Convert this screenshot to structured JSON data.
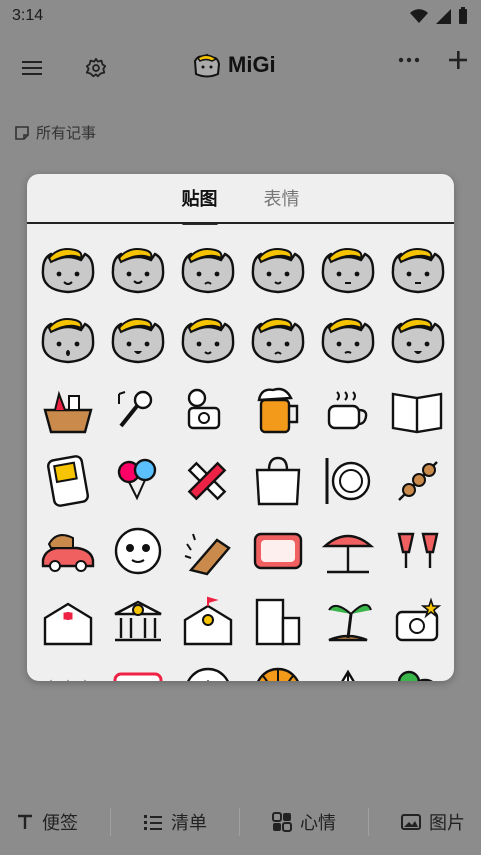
{
  "status": {
    "time": "3:14"
  },
  "brand": {
    "name": "MiGi"
  },
  "notes": {
    "label": "所有记事"
  },
  "sheet": {
    "tabs": [
      "贴图",
      "表情"
    ],
    "active_index": 0
  },
  "stickers": [
    {
      "type": "cat-happy"
    },
    {
      "type": "cat-smile"
    },
    {
      "type": "cat-angry"
    },
    {
      "type": "cat-wink"
    },
    {
      "type": "cat-sleepy"
    },
    {
      "type": "cat-serious"
    },
    {
      "type": "cat-surprised"
    },
    {
      "type": "cat-laugh"
    },
    {
      "type": "cat-shy"
    },
    {
      "type": "cat-cry"
    },
    {
      "type": "cat-tired"
    },
    {
      "type": "cat-happy2"
    },
    {
      "type": "basket-icon"
    },
    {
      "type": "music-mic-icon"
    },
    {
      "type": "camera-film-icon"
    },
    {
      "type": "beer-icon"
    },
    {
      "type": "coffee-icon"
    },
    {
      "type": "book-icon"
    },
    {
      "type": "gameboy-icon"
    },
    {
      "type": "balloons-icon"
    },
    {
      "type": "ruler-pencil-icon"
    },
    {
      "type": "shop-bag-icon"
    },
    {
      "type": "plate-icon"
    },
    {
      "type": "bbq-icon"
    },
    {
      "type": "car-icon"
    },
    {
      "type": "panda-face-icon"
    },
    {
      "type": "broom-icon"
    },
    {
      "type": "live-tv-icon"
    },
    {
      "type": "umbrella-beach-icon"
    },
    {
      "type": "cheers-icon"
    },
    {
      "type": "hospital-icon"
    },
    {
      "type": "bank-icon"
    },
    {
      "type": "school-icon"
    },
    {
      "type": "building-icon"
    },
    {
      "type": "palm-island-icon"
    },
    {
      "type": "photo-camera-star-icon"
    },
    {
      "type": "candles-icon"
    },
    {
      "type": "calendar-icon"
    },
    {
      "type": "soccer-icon"
    },
    {
      "type": "basketball-icon"
    },
    {
      "type": "tent-icon"
    },
    {
      "type": "tennis-icon"
    }
  ],
  "bottom": {
    "items": [
      {
        "label": "便签",
        "icon": "text-icon"
      },
      {
        "label": "清单",
        "icon": "list-icon"
      },
      {
        "label": "心情",
        "icon": "mood-icon"
      },
      {
        "label": "图片",
        "icon": "image-icon"
      }
    ]
  }
}
